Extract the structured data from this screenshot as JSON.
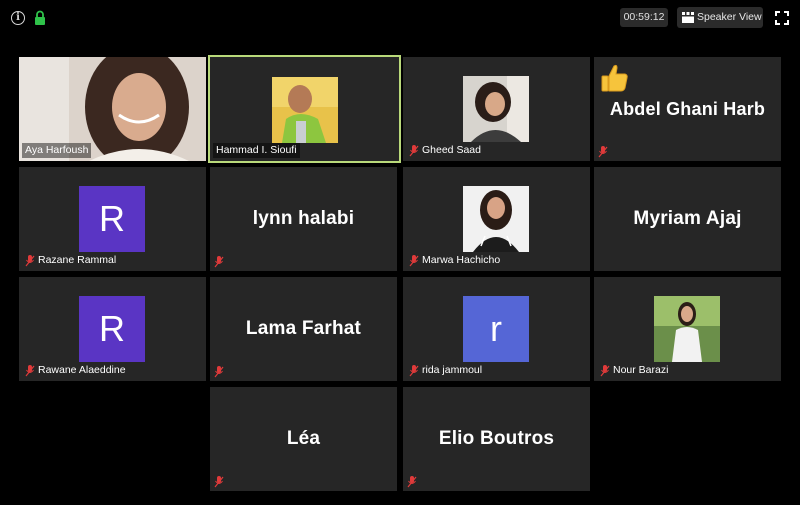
{
  "meeting": {
    "timer": "00:59:12",
    "speaker_view_label": "Speaker View"
  },
  "participants": [
    {
      "name": "Aya Harfoush"
    },
    {
      "name": "Hammad I. Sioufi"
    },
    {
      "name": "Gheed Saad"
    },
    {
      "name": "Abdel Ghani Harb"
    },
    {
      "name": "Razane Rammal",
      "avatar_letter": "R",
      "avatar_color": "#5a35c4"
    },
    {
      "name": "lynn halabi"
    },
    {
      "name": "Marwa Hachicho"
    },
    {
      "name": "Myriam Ajaj"
    },
    {
      "name": "Rawane Alaeddine",
      "avatar_letter": "R",
      "avatar_color": "#5a35c4"
    },
    {
      "name": "Lama Farhat"
    },
    {
      "name": "rida jammoul",
      "avatar_letter": "r",
      "avatar_color": "#5566d6"
    },
    {
      "name": "Nour Barazi"
    },
    {
      "name": "Léa"
    },
    {
      "name": "Elio Boutros"
    }
  ],
  "colors": {
    "active_speaker_border": "#b9d97a",
    "muted_red": "#e03a3a",
    "tile_bg": "#262626"
  }
}
